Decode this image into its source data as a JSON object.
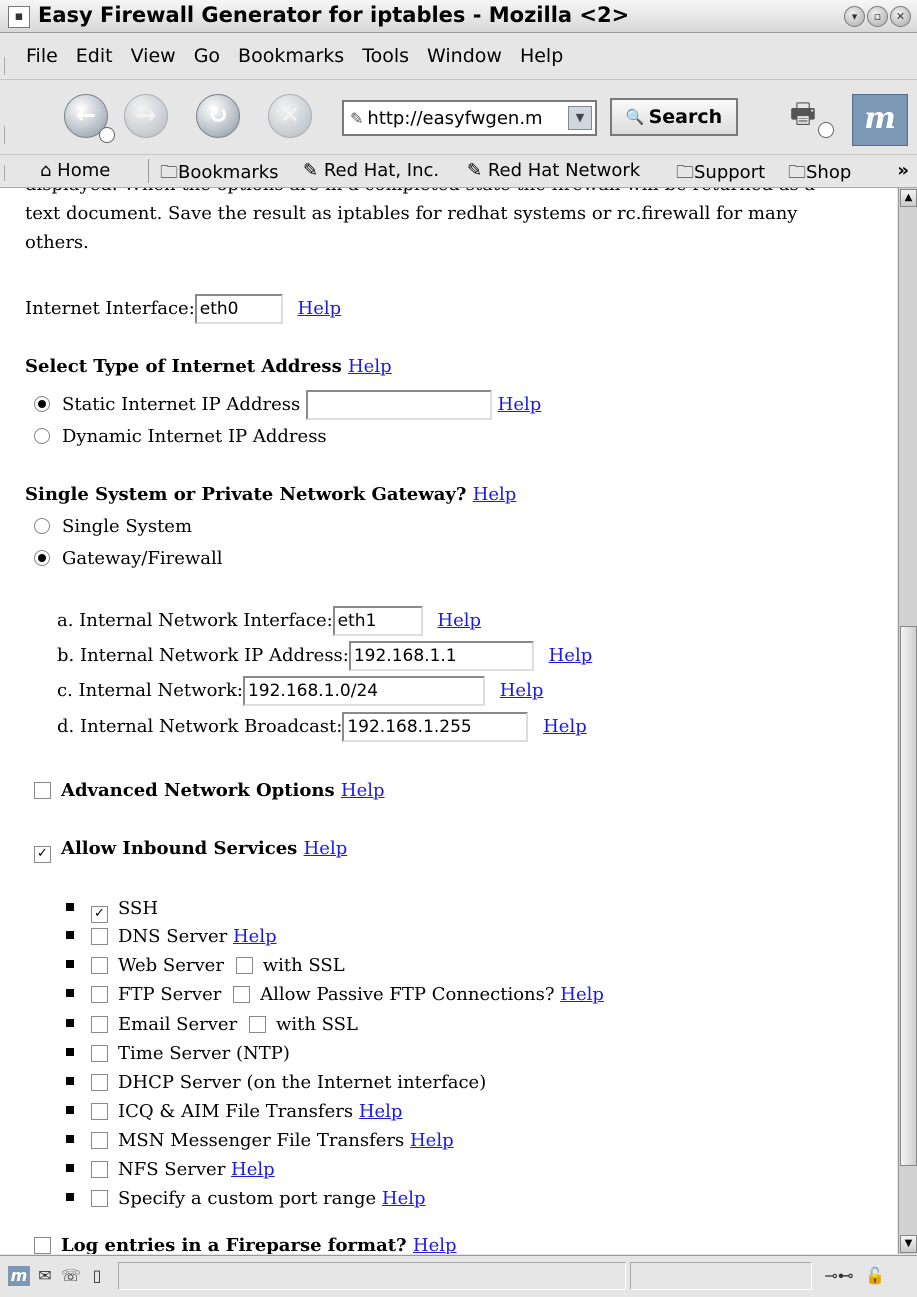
{
  "window": {
    "title": "Easy Firewall Generator for iptables - Mozilla <2>"
  },
  "menu": [
    "File",
    "Edit",
    "View",
    "Go",
    "Bookmarks",
    "Tools",
    "Window",
    "Help"
  ],
  "nav": {
    "url": "http://easyfwgen.m",
    "search_label": "Search"
  },
  "personal_toolbar": {
    "home": "Home",
    "bookmarks": "Bookmarks",
    "redhat": "Red Hat, Inc.",
    "redhat_network": "Red Hat Network",
    "support": "Support",
    "shop": "Shop",
    "more": "»"
  },
  "content": {
    "intro_partial": "displayed. When the options are in a completed state the firewall will be returned as a",
    "intro_line2": "text document. Save the result as iptables for redhat systems or rc.firewall for many",
    "intro_line3": "others.",
    "help": "Help",
    "internet_interface": {
      "label": "Internet Interface:",
      "value": "eth0"
    },
    "address_type": {
      "heading": "Select Type of Internet Address",
      "static_label": "Static Internet IP Address",
      "static_value": "",
      "dynamic_label": "Dynamic Internet IP Address",
      "selected": "static"
    },
    "system_type": {
      "heading": "Single System or Private Network Gateway?",
      "single_label": "Single System",
      "gateway_label": "Gateway/Firewall",
      "selected": "gateway"
    },
    "internal": {
      "a_label": "a. Internal Network Interface:",
      "a_value": "eth1",
      "b_label": "b. Internal Network IP Address:",
      "b_value": "192.168.1.1",
      "c_label": "c. Internal Network:",
      "c_value": "192.168.1.0/24",
      "d_label": "d. Internal Network Broadcast:",
      "d_value": "192.168.1.255"
    },
    "advanced": {
      "label": "Advanced Network Options",
      "checked": false
    },
    "inbound": {
      "label": "Allow Inbound Services",
      "checked": true
    },
    "services": {
      "ssh": "SSH",
      "dns": "DNS Server",
      "web": "Web Server",
      "web_ssl": "with SSL",
      "ftp": "FTP Server",
      "ftp_passive": "Allow Passive FTP Connections?",
      "email": "Email Server",
      "email_ssl": "with SSL",
      "time": "Time Server (NTP)",
      "dhcp": "DHCP Server (on the Internet interface)",
      "icq": "ICQ & AIM File Transfers",
      "msn": "MSN Messenger File Transfers",
      "nfs": "NFS Server",
      "custom": "Specify a custom port range"
    },
    "fireparse": {
      "label": "Log entries in a Fireparse format?",
      "checked": false
    }
  },
  "icons": {
    "back": "back-arrow-icon",
    "forward": "forward-arrow-icon",
    "reload": "reload-icon",
    "stop": "stop-icon",
    "print": "print-icon",
    "throbber": "mozilla-logo-icon"
  }
}
